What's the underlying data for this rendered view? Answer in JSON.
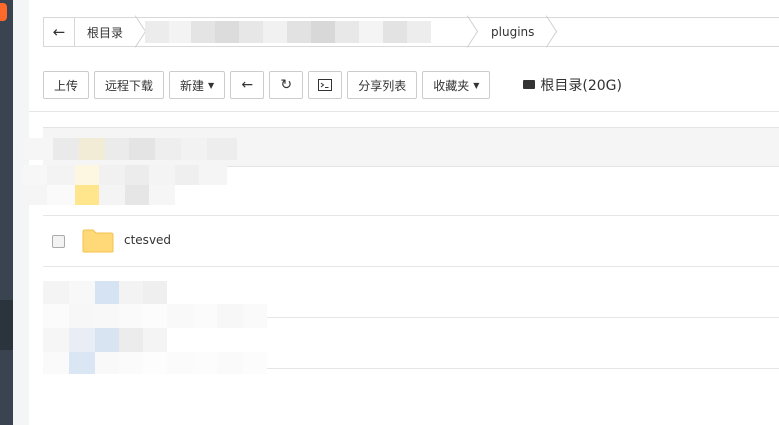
{
  "breadcrumb": {
    "back_icon": "arrow-left-icon",
    "root_label": "根目录",
    "current_label": "plugins"
  },
  "toolbar": {
    "upload": "上传",
    "remote_download": "远程下载",
    "new": "新建",
    "back_icon": "arrow-left-icon",
    "refresh_icon": "refresh-icon",
    "terminal_icon": "terminal-icon",
    "share_list": "分享列表",
    "favorites": "收藏夹",
    "disk_label": "根目录(20G)"
  },
  "table": {
    "rows": [
      {
        "name": "ctesved",
        "type": "folder"
      }
    ]
  },
  "colors": {
    "folder": "#ffd978",
    "sidebar": "#3a4450",
    "badge": "#ff6a2b"
  }
}
